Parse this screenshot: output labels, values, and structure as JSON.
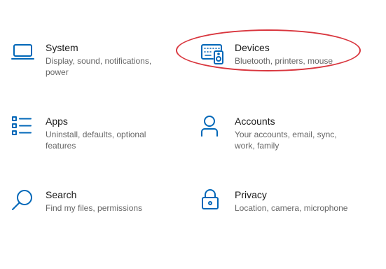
{
  "accent_color": "#0067b8",
  "annotation_color": "#d9363e",
  "tiles": [
    {
      "title": "System",
      "desc": "Display, sound, notifications, power",
      "icon": "laptop-icon"
    },
    {
      "title": "Devices",
      "desc": "Bluetooth, printers, mouse",
      "icon": "keyboard-speaker-icon"
    },
    {
      "title": "Apps",
      "desc": "Uninstall, defaults, optional features",
      "icon": "apps-list-icon"
    },
    {
      "title": "Accounts",
      "desc": "Your accounts, email, sync, work, family",
      "icon": "person-icon"
    },
    {
      "title": "Search",
      "desc": "Find my files, permissions",
      "icon": "magnifier-icon"
    },
    {
      "title": "Privacy",
      "desc": "Location, camera, microphone",
      "icon": "lock-icon"
    }
  ]
}
